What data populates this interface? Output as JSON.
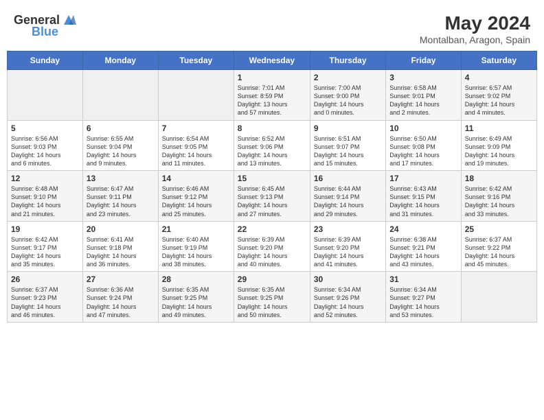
{
  "header": {
    "logo_general": "General",
    "logo_blue": "Blue",
    "month": "May 2024",
    "location": "Montalban, Aragon, Spain"
  },
  "days_of_week": [
    "Sunday",
    "Monday",
    "Tuesday",
    "Wednesday",
    "Thursday",
    "Friday",
    "Saturday"
  ],
  "weeks": [
    [
      {
        "day": "",
        "content": ""
      },
      {
        "day": "",
        "content": ""
      },
      {
        "day": "",
        "content": ""
      },
      {
        "day": "1",
        "content": "Sunrise: 7:01 AM\nSunset: 8:59 PM\nDaylight: 13 hours\nand 57 minutes."
      },
      {
        "day": "2",
        "content": "Sunrise: 7:00 AM\nSunset: 9:00 PM\nDaylight: 14 hours\nand 0 minutes."
      },
      {
        "day": "3",
        "content": "Sunrise: 6:58 AM\nSunset: 9:01 PM\nDaylight: 14 hours\nand 2 minutes."
      },
      {
        "day": "4",
        "content": "Sunrise: 6:57 AM\nSunset: 9:02 PM\nDaylight: 14 hours\nand 4 minutes."
      }
    ],
    [
      {
        "day": "5",
        "content": "Sunrise: 6:56 AM\nSunset: 9:03 PM\nDaylight: 14 hours\nand 6 minutes."
      },
      {
        "day": "6",
        "content": "Sunrise: 6:55 AM\nSunset: 9:04 PM\nDaylight: 14 hours\nand 9 minutes."
      },
      {
        "day": "7",
        "content": "Sunrise: 6:54 AM\nSunset: 9:05 PM\nDaylight: 14 hours\nand 11 minutes."
      },
      {
        "day": "8",
        "content": "Sunrise: 6:52 AM\nSunset: 9:06 PM\nDaylight: 14 hours\nand 13 minutes."
      },
      {
        "day": "9",
        "content": "Sunrise: 6:51 AM\nSunset: 9:07 PM\nDaylight: 14 hours\nand 15 minutes."
      },
      {
        "day": "10",
        "content": "Sunrise: 6:50 AM\nSunset: 9:08 PM\nDaylight: 14 hours\nand 17 minutes."
      },
      {
        "day": "11",
        "content": "Sunrise: 6:49 AM\nSunset: 9:09 PM\nDaylight: 14 hours\nand 19 minutes."
      }
    ],
    [
      {
        "day": "12",
        "content": "Sunrise: 6:48 AM\nSunset: 9:10 PM\nDaylight: 14 hours\nand 21 minutes."
      },
      {
        "day": "13",
        "content": "Sunrise: 6:47 AM\nSunset: 9:11 PM\nDaylight: 14 hours\nand 23 minutes."
      },
      {
        "day": "14",
        "content": "Sunrise: 6:46 AM\nSunset: 9:12 PM\nDaylight: 14 hours\nand 25 minutes."
      },
      {
        "day": "15",
        "content": "Sunrise: 6:45 AM\nSunset: 9:13 PM\nDaylight: 14 hours\nand 27 minutes."
      },
      {
        "day": "16",
        "content": "Sunrise: 6:44 AM\nSunset: 9:14 PM\nDaylight: 14 hours\nand 29 minutes."
      },
      {
        "day": "17",
        "content": "Sunrise: 6:43 AM\nSunset: 9:15 PM\nDaylight: 14 hours\nand 31 minutes."
      },
      {
        "day": "18",
        "content": "Sunrise: 6:42 AM\nSunset: 9:16 PM\nDaylight: 14 hours\nand 33 minutes."
      }
    ],
    [
      {
        "day": "19",
        "content": "Sunrise: 6:42 AM\nSunset: 9:17 PM\nDaylight: 14 hours\nand 35 minutes."
      },
      {
        "day": "20",
        "content": "Sunrise: 6:41 AM\nSunset: 9:18 PM\nDaylight: 14 hours\nand 36 minutes."
      },
      {
        "day": "21",
        "content": "Sunrise: 6:40 AM\nSunset: 9:19 PM\nDaylight: 14 hours\nand 38 minutes."
      },
      {
        "day": "22",
        "content": "Sunrise: 6:39 AM\nSunset: 9:20 PM\nDaylight: 14 hours\nand 40 minutes."
      },
      {
        "day": "23",
        "content": "Sunrise: 6:39 AM\nSunset: 9:20 PM\nDaylight: 14 hours\nand 41 minutes."
      },
      {
        "day": "24",
        "content": "Sunrise: 6:38 AM\nSunset: 9:21 PM\nDaylight: 14 hours\nand 43 minutes."
      },
      {
        "day": "25",
        "content": "Sunrise: 6:37 AM\nSunset: 9:22 PM\nDaylight: 14 hours\nand 45 minutes."
      }
    ],
    [
      {
        "day": "26",
        "content": "Sunrise: 6:37 AM\nSunset: 9:23 PM\nDaylight: 14 hours\nand 46 minutes."
      },
      {
        "day": "27",
        "content": "Sunrise: 6:36 AM\nSunset: 9:24 PM\nDaylight: 14 hours\nand 47 minutes."
      },
      {
        "day": "28",
        "content": "Sunrise: 6:35 AM\nSunset: 9:25 PM\nDaylight: 14 hours\nand 49 minutes."
      },
      {
        "day": "29",
        "content": "Sunrise: 6:35 AM\nSunset: 9:25 PM\nDaylight: 14 hours\nand 50 minutes."
      },
      {
        "day": "30",
        "content": "Sunrise: 6:34 AM\nSunset: 9:26 PM\nDaylight: 14 hours\nand 52 minutes."
      },
      {
        "day": "31",
        "content": "Sunrise: 6:34 AM\nSunset: 9:27 PM\nDaylight: 14 hours\nand 53 minutes."
      },
      {
        "day": "",
        "content": ""
      }
    ]
  ]
}
